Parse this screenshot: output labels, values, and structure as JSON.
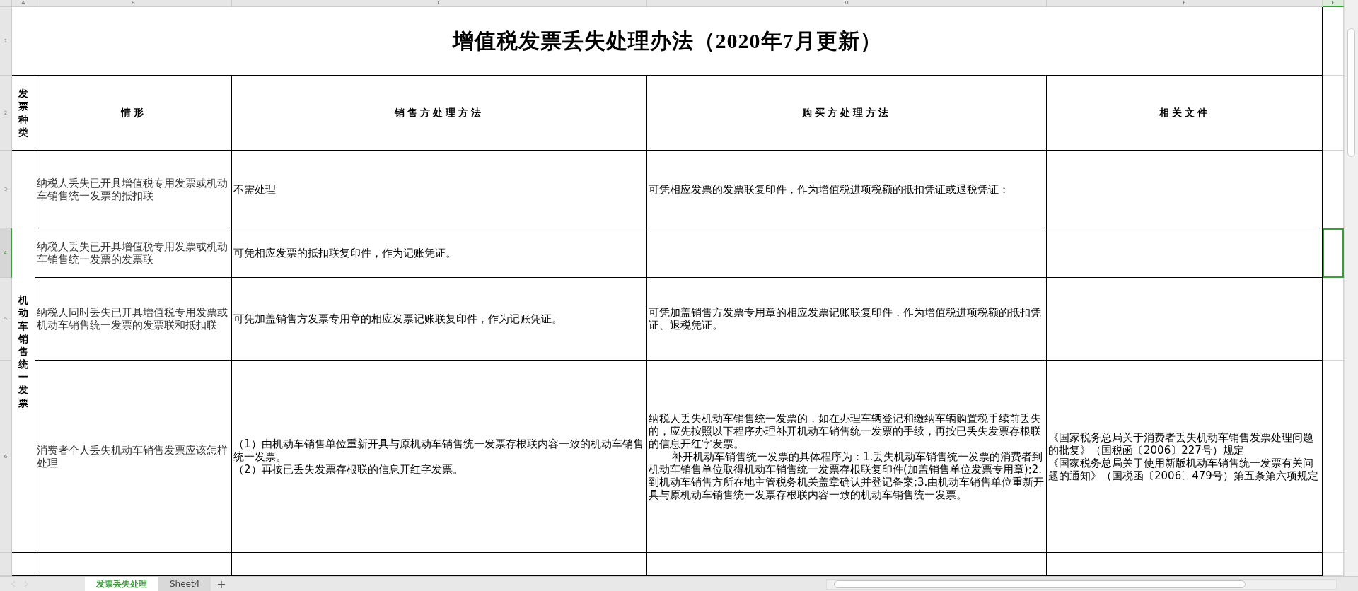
{
  "column_headers": [
    {
      "label": "A",
      "selected": false
    },
    {
      "label": "B",
      "selected": false
    },
    {
      "label": "C",
      "selected": false
    },
    {
      "label": "D",
      "selected": false
    },
    {
      "label": "E",
      "selected": false
    },
    {
      "label": "F",
      "selected": true
    }
  ],
  "row_headers": [
    {
      "label": "1",
      "selected": false
    },
    {
      "label": "2",
      "selected": false
    },
    {
      "label": "3",
      "selected": false
    },
    {
      "label": "4",
      "selected": true
    },
    {
      "label": "5",
      "selected": false
    },
    {
      "label": "6",
      "selected": false
    }
  ],
  "title": "增值税发票丢失处理办法（2020年7月更新）",
  "table": {
    "columns": [
      "发票种类",
      "情形",
      "销售方处理方法",
      "购买方处理方法",
      "相关文件"
    ],
    "group_label": "机动车销售统一发票",
    "rows": [
      {
        "situation": "纳税人丢失已开具增值税专用发票或机动车销售统一发票的抵扣联",
        "seller": [
          {
            "text": "不需处理",
            "indent": false
          }
        ],
        "buyer": [
          {
            "text": "可凭相应发票的发票联复印件，作为增值税进项税额的抵扣凭证或退税凭证；",
            "indent": false
          }
        ]
      },
      {
        "situation": "纳税人丢失已开具增值税专用发票或机动车销售统一发票的发票联",
        "seller": [
          {
            "text": "可凭相应发票的抵扣联复印件，作为记账凭证。",
            "indent": false
          }
        ]
      },
      {
        "situation": "纳税人同时丢失已开具增值税专用发票或机动车销售统一发票的发票联和抵扣联",
        "seller": [
          {
            "text": "可凭加盖销售方发票专用章的相应发票记账联复印件，作为记账凭证。",
            "indent": false
          }
        ],
        "buyer": [
          {
            "text": "可凭加盖销售方发票专用章的相应发票记账联复印件，作为增值税进项税额的抵扣凭证、退税凭证。",
            "indent": false
          }
        ]
      },
      {
        "situation": "消费者个人丢失机动车销售发票应该怎样处理",
        "seller": [
          {
            "text": "（1）由机动车销售单位重新开具与原机动车销售统一发票存根联内容一致的机动车销售统一发票。",
            "indent": false
          },
          {
            "text": "（2）再按已丢失发票存根联的信息开红字发票。",
            "indent": false
          }
        ],
        "buyer": [
          {
            "text": "纳税人丢失机动车销售统一发票的，如在办理车辆登记和缴纳车辆购置税手续前丢失的，应先按照以下程序办理补开机动车销售统一发票的手续，再按已丢失发票存根联的信息开红字发票。",
            "indent": false
          },
          {
            "text": "补开机动车销售统一发票的具体程序为：1.丢失机动车销售统一发票的消费者到机动车销售单位取得机动车销售统一发票存根联复印件(加盖销售单位发票专用章);2.到机动车销售方所在地主管税务机关盖章确认并登记备案;3.由机动车销售单位重新开具与原机动车销售统一发票存根联内容一致的机动车销售统一发票。",
            "indent": true
          }
        ],
        "documents": [
          {
            "text": "《国家税务总局关于消费者丢失机动车销售发票处理问题的批复》（国税函〔2006〕227号）规定",
            "indent": false
          },
          {
            "text": "《国家税务总局关于使用新版机动车销售统一发票有关问题的通知》（国税函〔2006〕479号）第五条第六项规定",
            "indent": false
          }
        ]
      }
    ]
  },
  "sheet_tabs": [
    {
      "label": "发票丢失处理",
      "selected": true
    },
    {
      "label": "Sheet4",
      "selected": false
    }
  ],
  "add_sheet": "+"
}
